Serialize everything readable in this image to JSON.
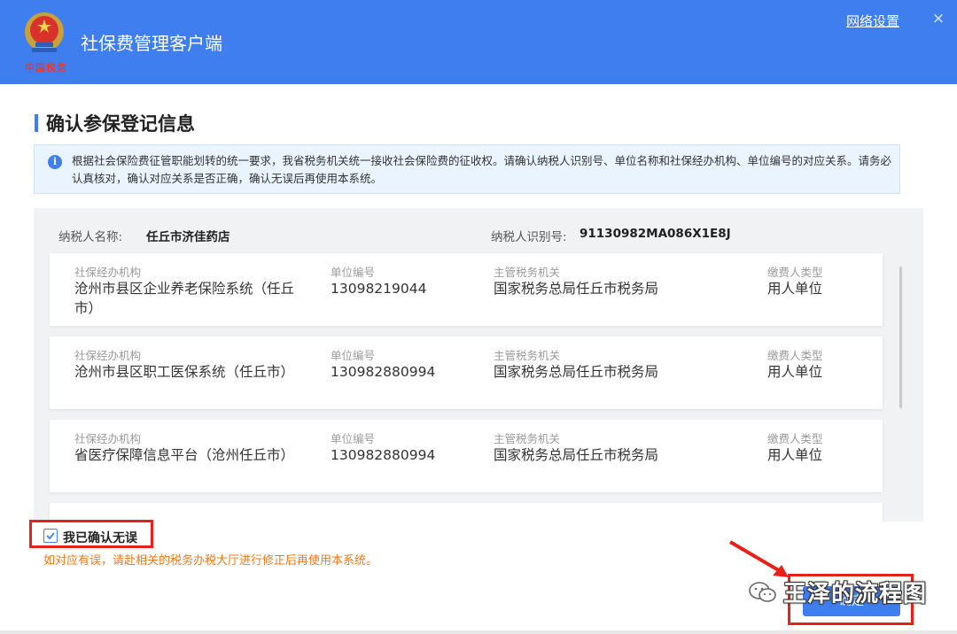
{
  "window": {
    "title": "社保费管理客户端",
    "brand_script": "中国税务",
    "network_settings": "网络设置",
    "close_glyph": "×"
  },
  "page": {
    "section_title": "确认参保登记信息",
    "notice": "根据社会保险费征管职能划转的统一要求，我省税务机关统一接收社会保险费的征收权。请确认纳税人识别号、单位名称和社保经办机构、单位编号的对应关系。请务必认真核对，确认对应关系是否正确，确认无误后再使用本系统。"
  },
  "taxpayer": {
    "name_label": "纳税人名称:",
    "name_value": "任丘市济佳药店",
    "id_label": "纳税人识别号:",
    "id_value": "91130982MA086X1E8J"
  },
  "columns": {
    "org": "社保经办机构",
    "unit_no": "单位编号",
    "tax_office": "主管税务机关",
    "payer_type": "缴费人类型"
  },
  "records": [
    {
      "org": "沧州市县区企业养老保险系统（任丘市）",
      "unit_no": "13098219044",
      "tax_office": "国家税务总局任丘市税务局",
      "payer_type": "用人单位"
    },
    {
      "org": "沧州市县区职工医保系统（任丘市）",
      "unit_no": "130982880994",
      "tax_office": "国家税务总局任丘市税务局",
      "payer_type": "用人单位"
    },
    {
      "org": "省医疗保障信息平台（沧州任丘市）",
      "unit_no": "130982880994",
      "tax_office": "国家税务总局任丘市税务局",
      "payer_type": "用人单位"
    }
  ],
  "confirm": {
    "label": "我已确认无误",
    "checked": true,
    "warning": "如对应有误，请赴相关的税务办税大厅进行修正后再使用本系统。"
  },
  "actions": {
    "ok_label": "确定"
  },
  "watermark": "王泽的流程图",
  "colors": {
    "accent": "#3f7eee",
    "highlight": "#e8201a",
    "warning": "#f07a19"
  }
}
